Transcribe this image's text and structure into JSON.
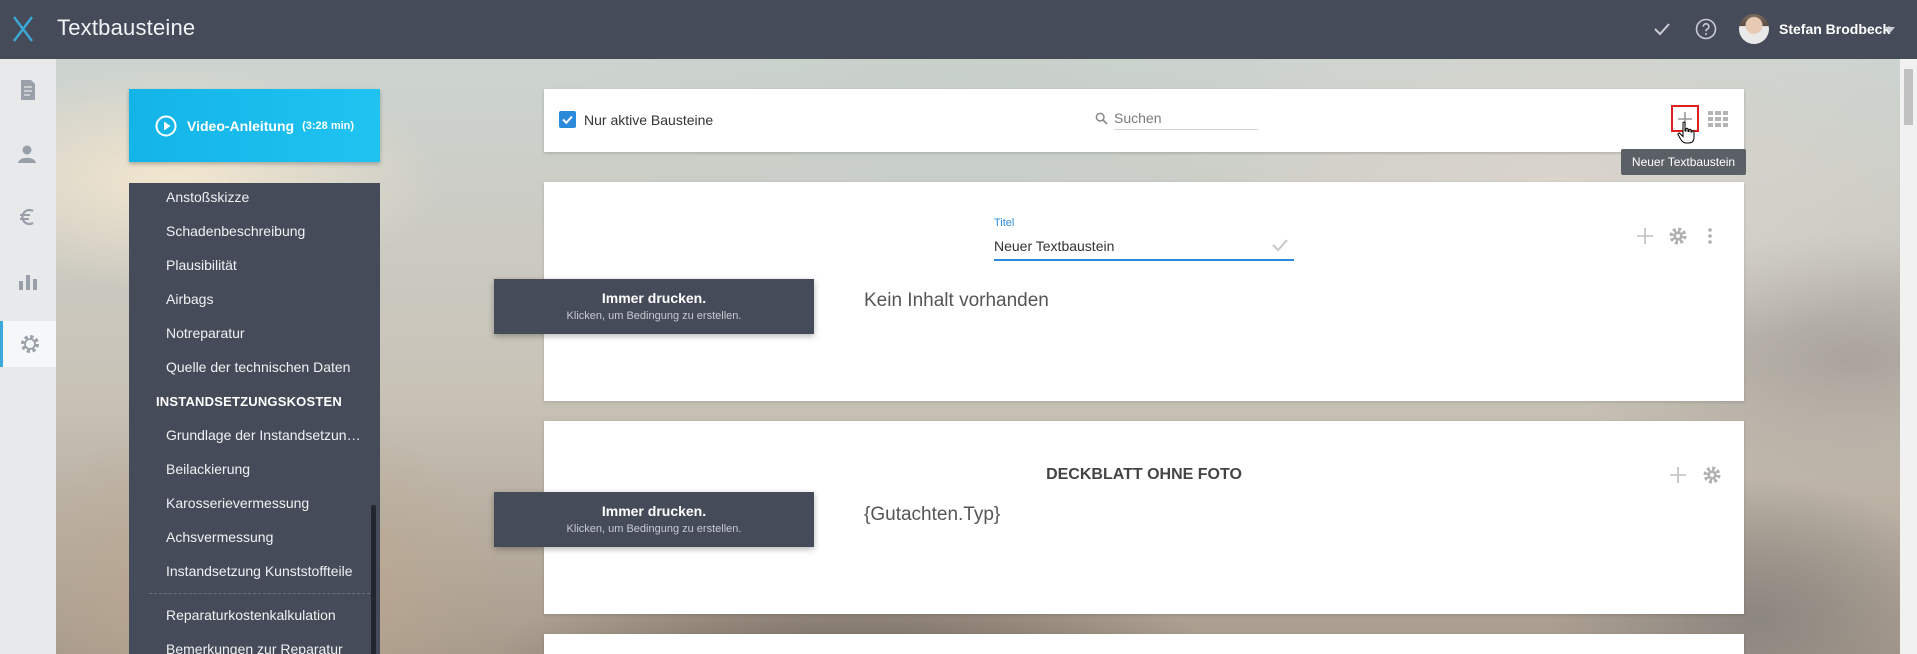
{
  "app": {
    "title": "Textbausteine"
  },
  "user": {
    "name": "Stefan Brodbeck"
  },
  "video": {
    "label": "Video-Anleitung",
    "duration": "(3:28 min)"
  },
  "sidebar": {
    "items": [
      {
        "label": "Anstoßskizze"
      },
      {
        "label": "Schadenbeschreibung"
      },
      {
        "label": "Plausibilität"
      },
      {
        "label": "Airbags"
      },
      {
        "label": "Notreparatur"
      },
      {
        "label": "Quelle der technischen Daten"
      },
      {
        "label": "INSTANDSETZUNGSKOSTEN",
        "header": true
      },
      {
        "label": "Grundlage der Instandsetzun…"
      },
      {
        "label": "Beilackierung"
      },
      {
        "label": "Karosserievermessung"
      },
      {
        "label": "Achsvermessung"
      },
      {
        "label": "Instandsetzung Kunststoffteile"
      },
      {
        "label": "Reparaturkostenkalkulation"
      },
      {
        "label": "Bemerkungen zur Reparatur"
      }
    ]
  },
  "toolbar": {
    "only_active_label": "Nur aktive Bausteine",
    "only_active_checked": true,
    "search_placeholder": "Suchen",
    "add_tooltip": "Neuer Textbaustein"
  },
  "cards": [
    {
      "field_label": "Titel",
      "title_value": "Neuer Textbaustein",
      "content": "Kein Inhalt vorhanden",
      "condition": {
        "title": "Immer drucken.",
        "hint": "Klicken, um Bedingung zu erstellen."
      }
    },
    {
      "title": "DECKBLATT OHNE FOTO",
      "content": "{Gutachten.Typ}",
      "condition": {
        "title": "Immer drucken.",
        "hint": "Klicken, um Bedingung zu erstellen."
      }
    }
  ],
  "colors": {
    "accent": "#2b8ad9",
    "topbar": "#454b59",
    "video": "#14b4e8",
    "highlight": "#e02020"
  }
}
